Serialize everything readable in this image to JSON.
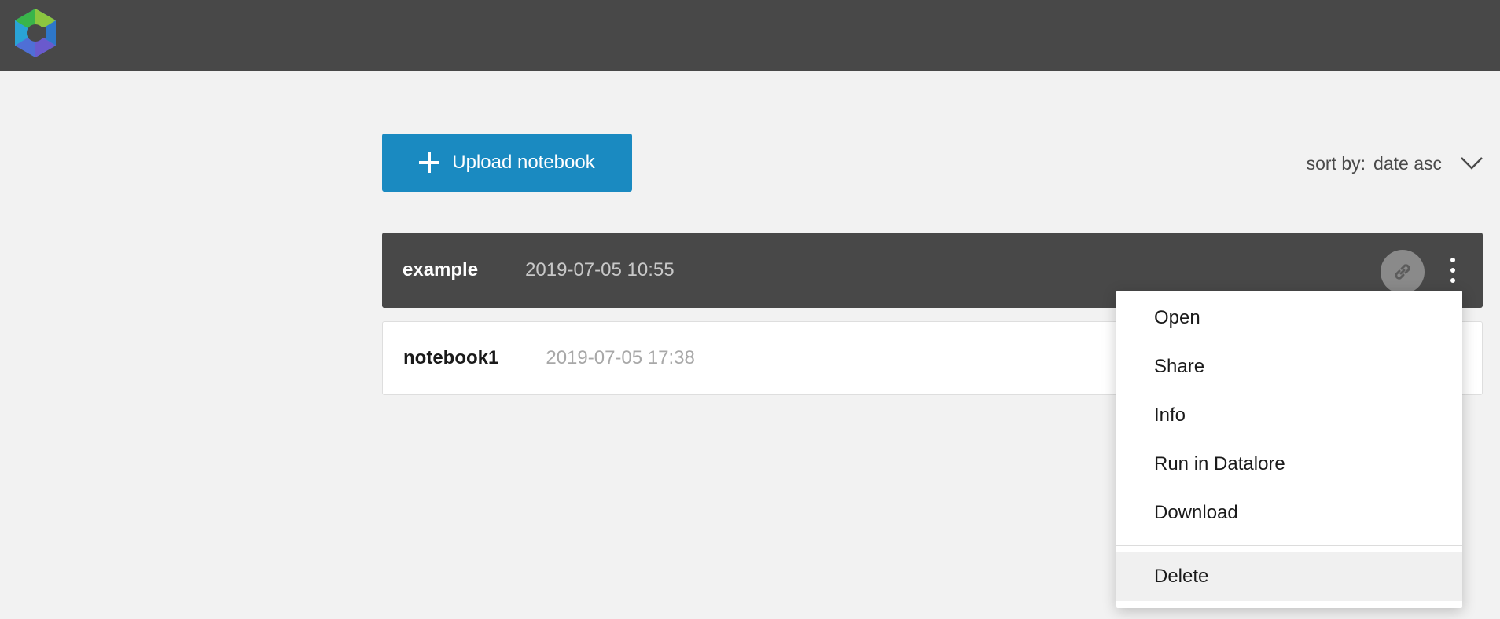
{
  "header": {
    "logo_icon": "datalore-hexagon-logo",
    "colors": {
      "bar": "#484848"
    }
  },
  "toolbar": {
    "upload_label": "Upload notebook",
    "upload_icon": "plus-icon",
    "sort_label": "sort by:",
    "sort_value": "date asc",
    "sort_icon": "chevron-down-icon"
  },
  "notebooks": [
    {
      "name": "example",
      "date": "2019-07-05 10:55",
      "selected": true
    },
    {
      "name": "notebook1",
      "date": "2019-07-05 17:38",
      "selected": false
    }
  ],
  "row_actions": {
    "link_icon": "link-icon",
    "menu_icon": "more-vertical-icon"
  },
  "context_menu": {
    "items": [
      "Open",
      "Share",
      "Info",
      "Run in Datalore",
      "Download"
    ],
    "danger_item": "Delete"
  },
  "colors": {
    "accent": "#1a8ac1",
    "selected_row": "#484848",
    "background": "#f2f2f2"
  }
}
